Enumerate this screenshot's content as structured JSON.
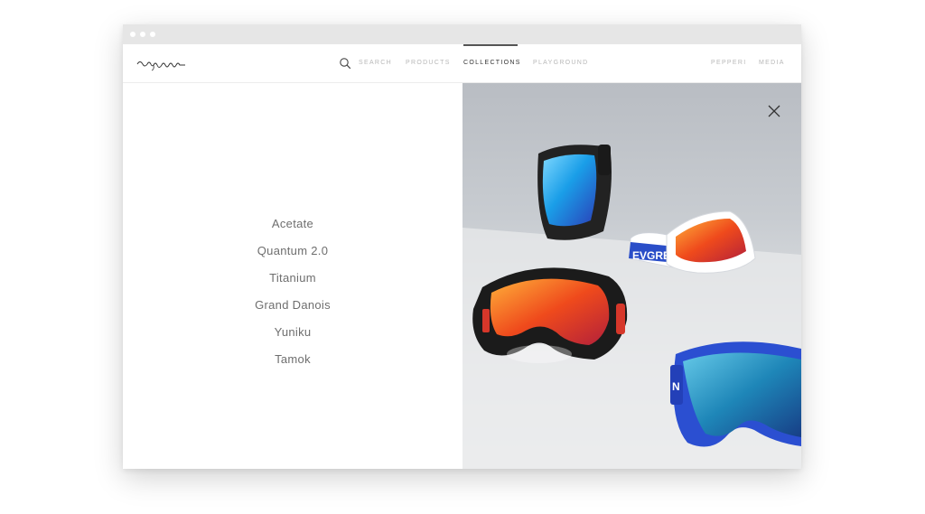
{
  "browser": {
    "controls": [
      "dot",
      "dot",
      "dot"
    ]
  },
  "brand": {
    "logo_text": "evgreen"
  },
  "nav": {
    "search_label": "SEARCH",
    "products_label": "PRODUCTS",
    "collections_label": "COLLECTIONS",
    "playground_label": "PLAYGROUND",
    "pepperi_label": "PEPPERI",
    "media_label": "MEDIA",
    "active": "COLLECTIONS"
  },
  "collections": {
    "items": [
      "Acetate",
      "Quantum 2.0",
      "Titanium",
      "Grand Danois",
      "Yuniku",
      "Tamok"
    ]
  },
  "photo": {
    "strap_text": "EVGREEN",
    "strap_text_2": "N"
  },
  "icons": {
    "search": "search-icon",
    "close": "close-icon"
  },
  "colors": {
    "nav_active": "#333333",
    "nav_inactive": "#b8b8b8",
    "menu_text": "#6e6e6e",
    "accent_blue": "#2a4ec8",
    "accent_orange": "#e8541e"
  }
}
